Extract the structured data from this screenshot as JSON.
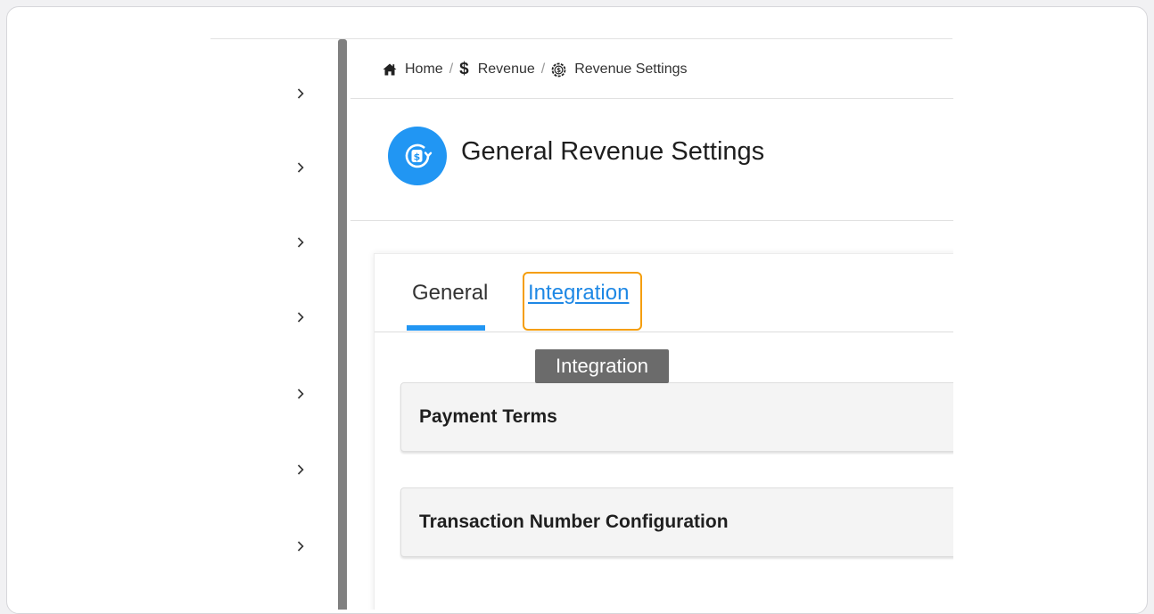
{
  "breadcrumb": {
    "home": "Home",
    "revenue": "Revenue",
    "revenue_settings": "Revenue Settings",
    "separator": "/",
    "revenue_symbol": "$"
  },
  "page": {
    "title": "General Revenue Settings"
  },
  "tabs": {
    "general": "General",
    "integration": "Integration"
  },
  "tooltip": {
    "text": "Integration"
  },
  "sections": [
    {
      "title": "Payment Terms"
    },
    {
      "title": "Transaction Number Configuration"
    }
  ],
  "sidebar": {
    "items": [
      {
        "icon": "chevron-right-icon"
      },
      {
        "icon": "chevron-right-icon"
      },
      {
        "icon": "chevron-right-icon"
      },
      {
        "icon": "chevron-right-icon"
      },
      {
        "icon": "chevron-right-icon"
      },
      {
        "icon": "chevron-right-icon"
      },
      {
        "icon": "chevron-right-icon"
      }
    ]
  },
  "colors": {
    "accent": "#2196f3",
    "link": "#1e88e5",
    "focus_outline": "#f59e0b",
    "tooltip_bg": "#6b6b6b",
    "scrollbar": "#808080"
  }
}
